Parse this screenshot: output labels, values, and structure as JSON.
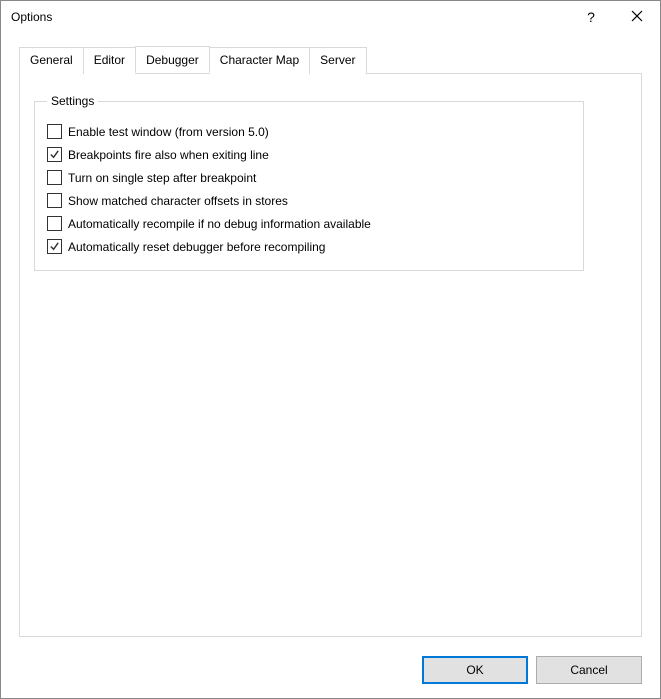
{
  "window": {
    "title": "Options"
  },
  "tabs": {
    "general": "General",
    "editor": "Editor",
    "debugger": "Debugger",
    "charmap": "Character Map",
    "server": "Server",
    "active": "debugger"
  },
  "settings": {
    "legend": "Settings",
    "items": [
      {
        "label": "Enable test window (from version 5.0)",
        "checked": false
      },
      {
        "label": "Breakpoints fire also when exiting line",
        "checked": true
      },
      {
        "label": "Turn on single step after breakpoint",
        "checked": false
      },
      {
        "label": "Show matched character offsets in stores",
        "checked": false
      },
      {
        "label": "Automatically recompile if no debug information available",
        "checked": false
      },
      {
        "label": "Automatically reset debugger before recompiling",
        "checked": true
      }
    ]
  },
  "buttons": {
    "ok": "OK",
    "cancel": "Cancel"
  }
}
